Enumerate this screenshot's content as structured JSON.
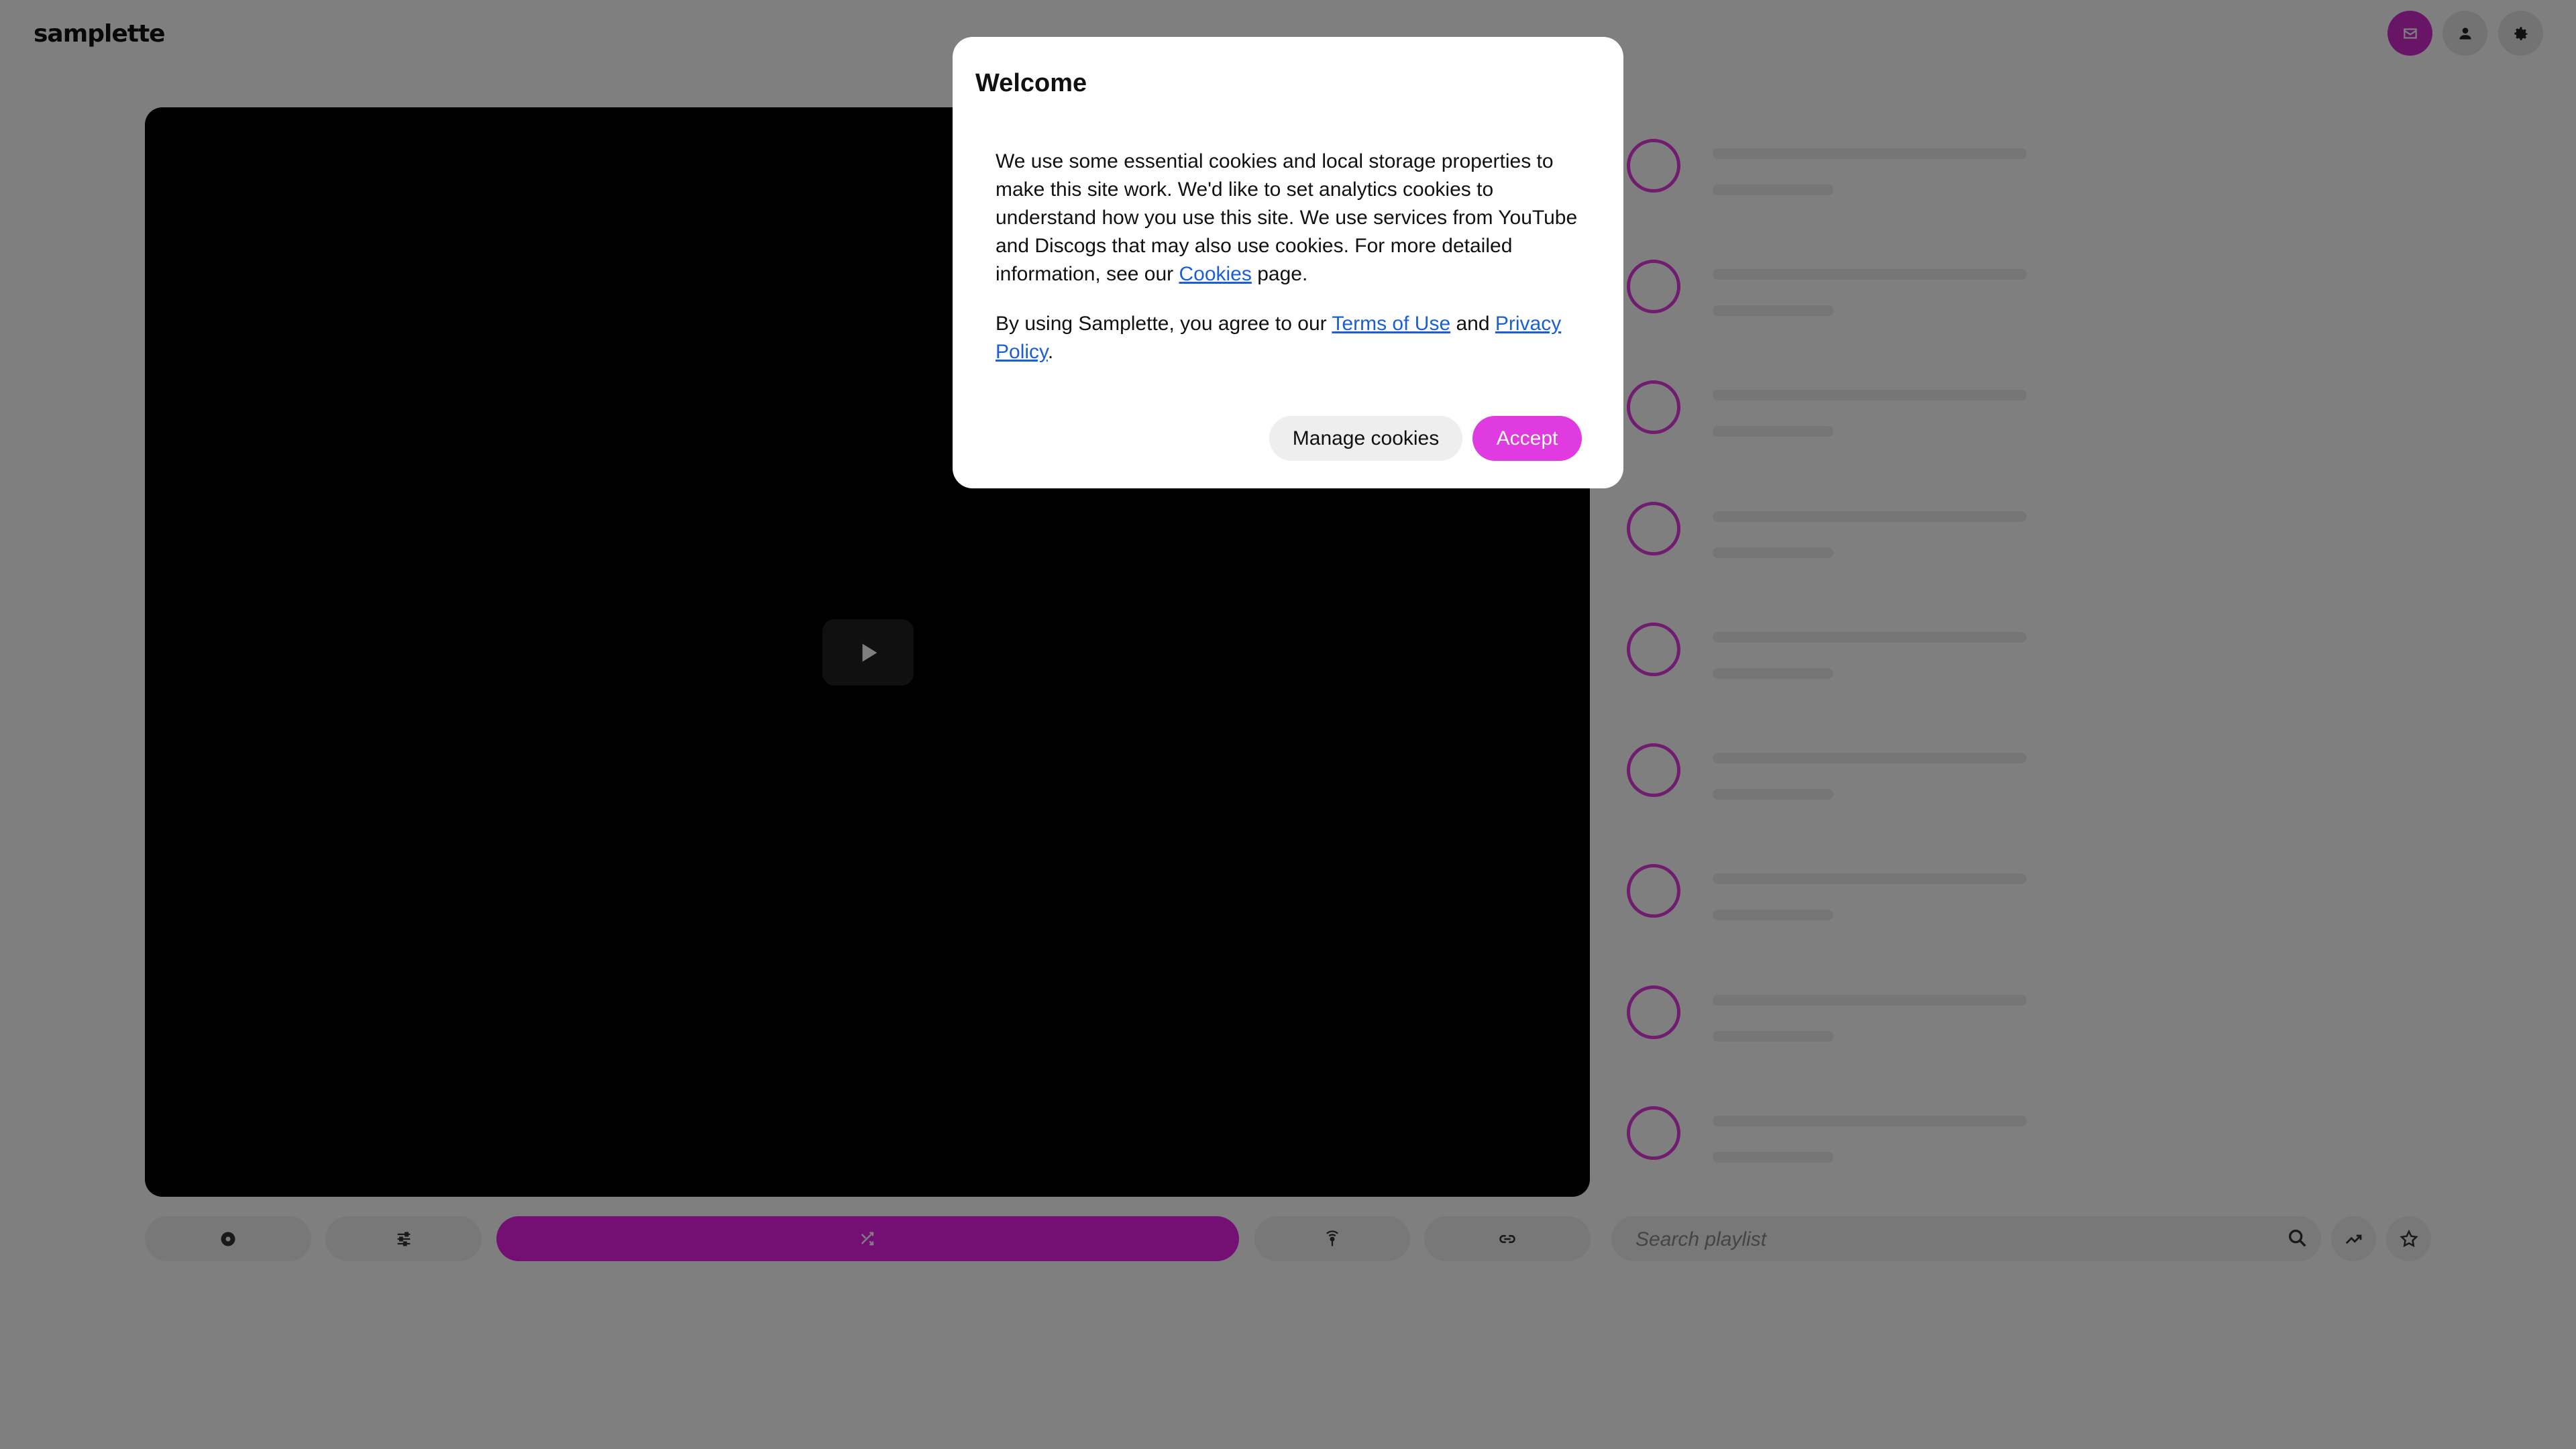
{
  "app": {
    "logo_text": "samplette",
    "accent_color": "#e03be0"
  },
  "header": {
    "icons": [
      "mail-icon",
      "user-icon",
      "gear-icon"
    ]
  },
  "player": {
    "play_icon": "play-icon"
  },
  "playlist": {
    "item_count": 9
  },
  "controls": {
    "icons": [
      "disc-icon",
      "sliders-icon",
      "shuffle-icon",
      "broadcast-icon",
      "link-icon"
    ],
    "search_placeholder": "Search playlist",
    "trending_icon": "trending-icon",
    "star_icon": "star-icon"
  },
  "modal": {
    "title": "Welcome",
    "paragraph1_a": "We use some essential cookies and local storage properties to make this site work. We'd like to set analytics cookies to understand how you use this site. We use services from YouTube and Discogs that may also use cookies. For more detailed information, see our ",
    "cookies_link": "Cookies",
    "paragraph1_b": " page.",
    "paragraph2_a": "By using Samplette, you agree to our ",
    "terms_link": "Terms of Use",
    "paragraph2_and": " and ",
    "privacy_link": "Privacy Policy",
    "paragraph2_end": ".",
    "manage_label": "Manage cookies",
    "accept_label": "Accept"
  }
}
